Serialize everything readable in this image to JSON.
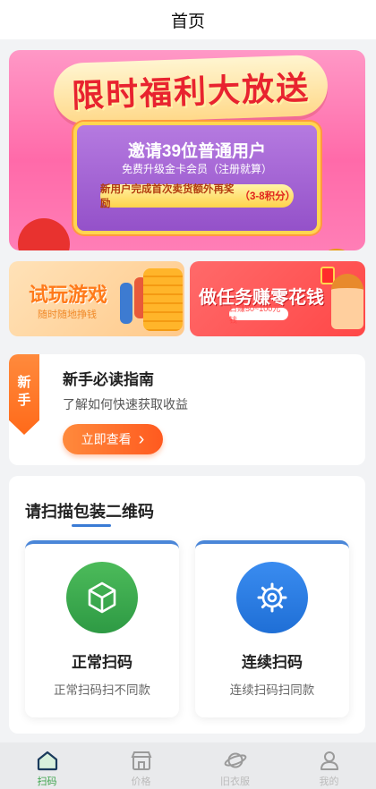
{
  "header": {
    "title": "首页"
  },
  "banner": {
    "headline": "限时福利大放送",
    "invite_line": "邀请39位普通用户",
    "upgrade_line": "免费升级金卡会员（注册就算）",
    "bonus_text": "新用户完成首次卖货额外再奖励",
    "bonus_highlight": "（3-8积分）"
  },
  "promos": {
    "left": {
      "title": "试玩游戏",
      "subtitle": "随时随地挣钱"
    },
    "right": {
      "title": "做任务赚零花钱",
      "subtitle": "日赚50~100元钱"
    }
  },
  "guide": {
    "tag": [
      "新",
      "手"
    ],
    "title": "新手必读指南",
    "subtitle": "了解如何快速获取收益",
    "button_label": "立即查看",
    "button_chevron": "›"
  },
  "scan": {
    "title": "请扫描包装二维码",
    "cards": [
      {
        "name": "正常扫码",
        "desc": "正常扫码扫不同款",
        "icon": "cube-icon"
      },
      {
        "name": "连续扫码",
        "desc": "连续扫码扫同款",
        "icon": "gear-icon"
      }
    ]
  },
  "tabbar": {
    "active_index": 0,
    "items": [
      {
        "label": "扫码",
        "icon": "home-icon"
      },
      {
        "label": "价格",
        "icon": "store-icon"
      },
      {
        "label": "旧衣服",
        "icon": "planet-icon"
      },
      {
        "label": "我的",
        "icon": "user-icon"
      }
    ]
  },
  "colors": {
    "accent_orange": "#ff6a1a",
    "active_green": "#3aa34a",
    "scan_blue": "#3a7bd5",
    "banner_pink": "#ff6aa9"
  }
}
